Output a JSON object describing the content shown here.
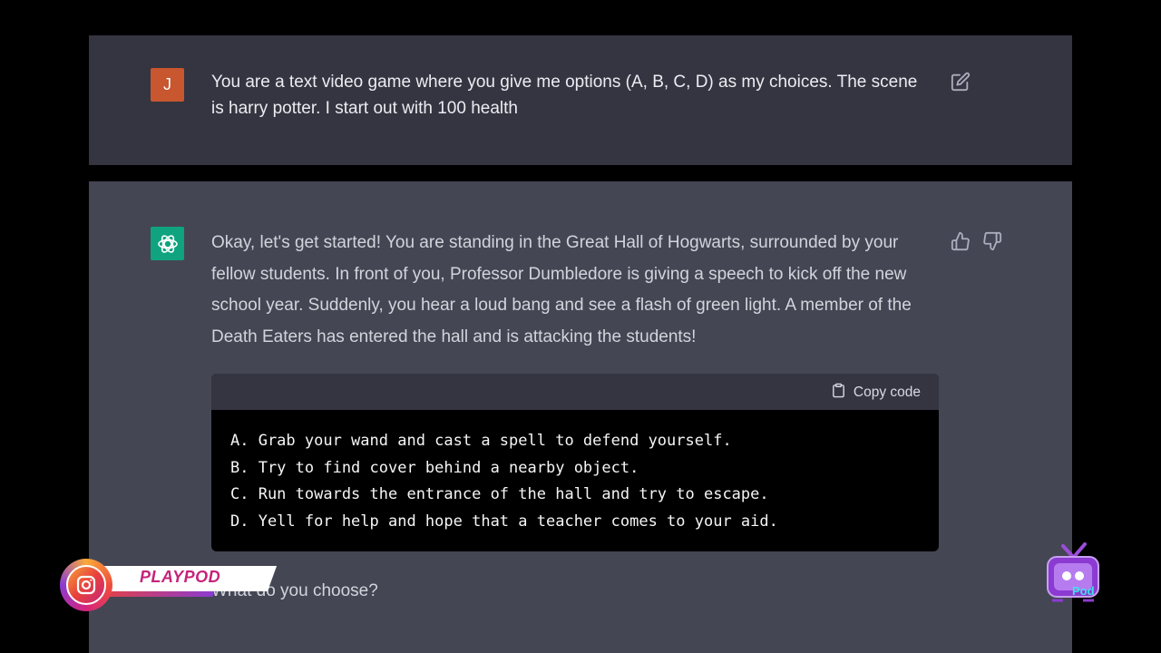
{
  "user_message": {
    "avatar_letter": "J",
    "text": "You are a text video game where you give me options (A, B, C, D) as my choices. The scene is harry potter. I start out with 100 health"
  },
  "assistant_message": {
    "intro": "Okay, let's get started! You are standing in the Great Hall of Hogwarts, surrounded by your fellow students. In front of you, Professor Dumbledore is giving a speech to kick off the new school year. Suddenly, you hear a loud bang and see a flash of green light. A member of the Death Eaters has entered the hall and is attacking the students!",
    "code_block": {
      "copy_label": "Copy code",
      "lines": [
        "A. Grab your wand and cast a spell to defend yourself.",
        "B. Try to find cover behind a nearby object.",
        "C. Run towards the entrance of the hall and try to escape.",
        "D. Yell for help and hope that a teacher comes to your aid."
      ]
    },
    "outro": "What do you choose?"
  },
  "overlay": {
    "badge_label": "PLAYPOD",
    "logo_text": "Pod"
  },
  "icons": {
    "edit": "edit-icon",
    "thumbs_up": "thumbs-up-icon",
    "thumbs_down": "thumbs-down-icon",
    "clipboard": "clipboard-icon",
    "openai": "openai-logo-icon",
    "instagram": "instagram-icon"
  },
  "colors": {
    "user_panel": "#343541",
    "assistant_panel": "#444654",
    "user_avatar": "#c8562f",
    "bot_avatar": "#10a37f",
    "code_bg": "#000000"
  }
}
